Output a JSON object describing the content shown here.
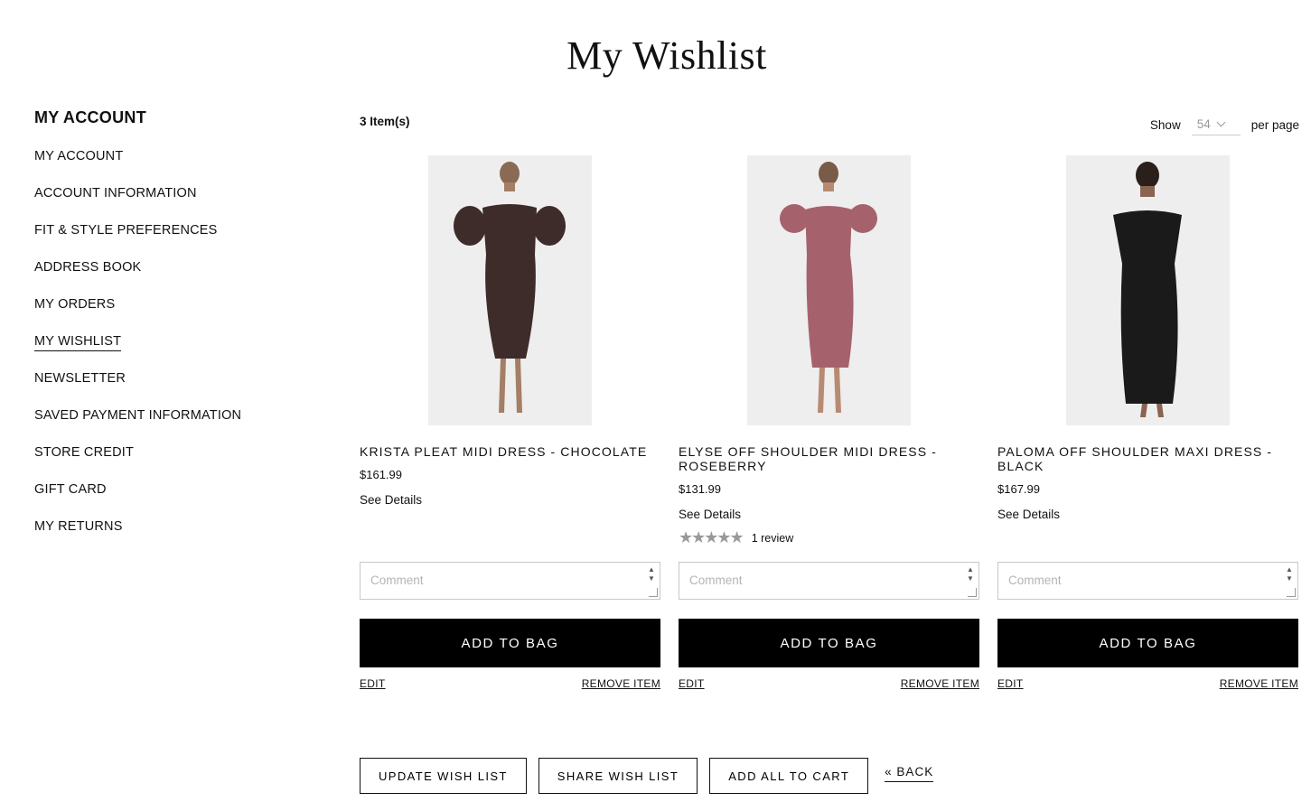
{
  "page": {
    "title": "My Wishlist"
  },
  "sidebar": {
    "title": "MY ACCOUNT",
    "items": [
      {
        "label": "MY ACCOUNT"
      },
      {
        "label": "ACCOUNT INFORMATION"
      },
      {
        "label": "FIT & STYLE PREFERENCES"
      },
      {
        "label": "ADDRESS BOOK"
      },
      {
        "label": "MY ORDERS"
      },
      {
        "label": "MY WISHLIST",
        "active": true
      },
      {
        "label": "NEWSLETTER"
      },
      {
        "label": "SAVED PAYMENT INFORMATION"
      },
      {
        "label": "STORE CREDIT"
      },
      {
        "label": "GIFT CARD"
      },
      {
        "label": "MY RETURNS"
      }
    ]
  },
  "toolbar": {
    "item_count": "3 Item(s)",
    "show_label": "Show",
    "per_page_value": "54",
    "per_page_label": "per page"
  },
  "products": [
    {
      "name": "KRISTA PLEAT MIDI DRESS - CHOCOLATE",
      "price": "$161.99",
      "see_details": "See Details",
      "dress_color": "#3e2c2a",
      "comment_placeholder": "Comment",
      "add_label": "ADD TO BAG",
      "edit_label": "EDIT",
      "remove_label": "REMOVE ITEM"
    },
    {
      "name": "ELYSE OFF SHOULDER MIDI DRESS - ROSEBERRY",
      "price": "$131.99",
      "see_details": "See Details",
      "rating_stars": 0,
      "rating_text": "1 review",
      "dress_color": "#a5626d",
      "comment_placeholder": "Comment",
      "add_label": "ADD TO BAG",
      "edit_label": "EDIT",
      "remove_label": "REMOVE ITEM"
    },
    {
      "name": "PALOMA OFF SHOULDER MAXI DRESS - BLACK",
      "price": "$167.99",
      "see_details": "See Details",
      "dress_color": "#1a1a1a",
      "comment_placeholder": "Comment",
      "add_label": "ADD TO BAG",
      "edit_label": "EDIT",
      "remove_label": "REMOVE ITEM"
    }
  ],
  "bottom_actions": {
    "update": "UPDATE WISH LIST",
    "share": "SHARE WISH LIST",
    "add_all": "ADD ALL TO CART",
    "back": "« BACK"
  }
}
